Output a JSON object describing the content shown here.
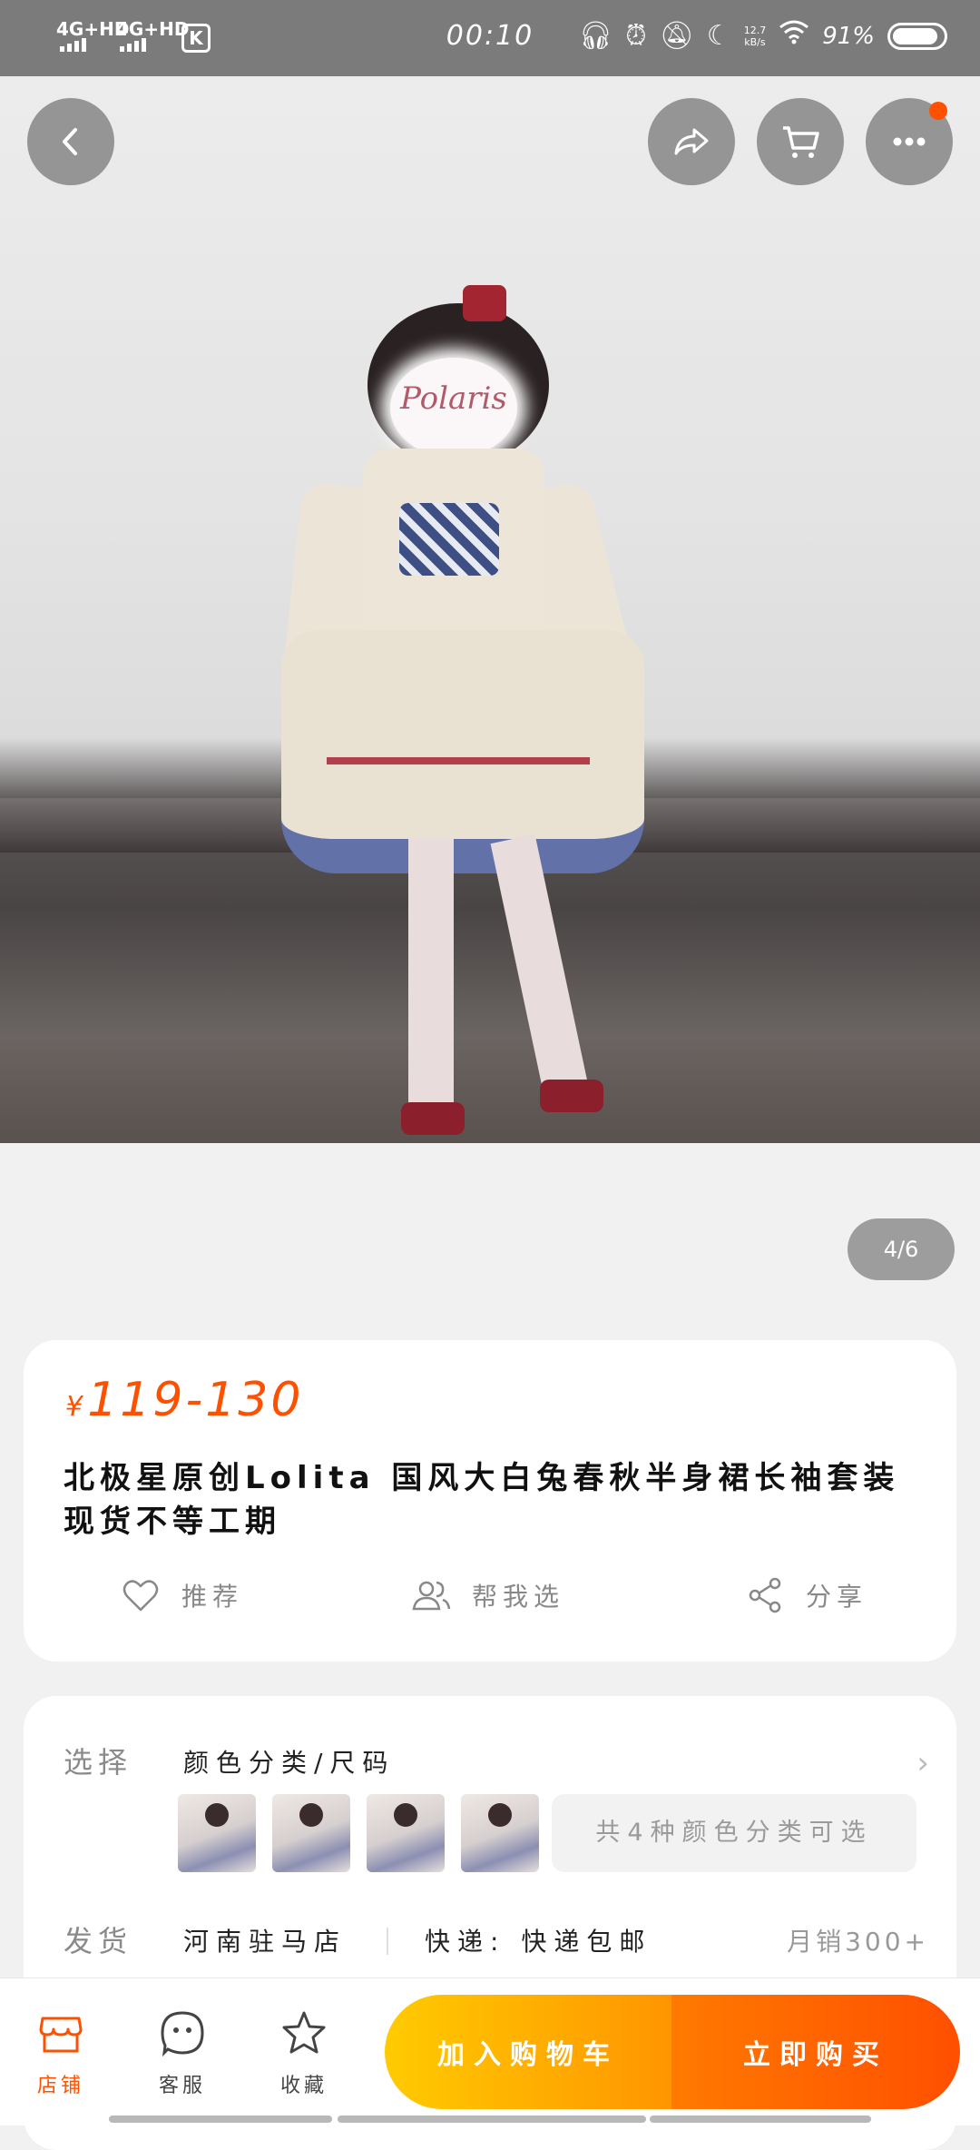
{
  "status_bar": {
    "network_1": "4G+HD",
    "network_2": "4G+HD",
    "app_badge": "K",
    "time": "00:10",
    "speed_value": "12.7",
    "speed_unit": "kB/s",
    "battery": "91%"
  },
  "gallery": {
    "logo_text": "Polaris",
    "counter": "4/6"
  },
  "product": {
    "currency_symbol": "¥",
    "price_range": "119-130",
    "title": "北极星原创Lolita 国风大白兔春秋半身裙长袖套装现货不等工期",
    "actions": {
      "recommend": "推荐",
      "help_choose": "帮我选",
      "share": "分享"
    }
  },
  "selection": {
    "label": "选择",
    "option_name": "颜色分类/尺码",
    "more_options": "共4种颜色分类可选",
    "thumbnail_count": 4
  },
  "shipping": {
    "label": "发货",
    "location": "河南驻马店",
    "method": "快递: 快递包邮",
    "monthly_sales": "月销300+"
  },
  "bottom_bar": {
    "shop": "店铺",
    "service": "客服",
    "favorite": "收藏",
    "add_to_cart": "加入购物车",
    "buy_now": "立即购买"
  },
  "colors": {
    "accent": "#ff5000",
    "cart_gradient": [
      "#ffcb00",
      "#ff9500"
    ],
    "buy_gradient": [
      "#ff7a00",
      "#ff4f00"
    ]
  }
}
